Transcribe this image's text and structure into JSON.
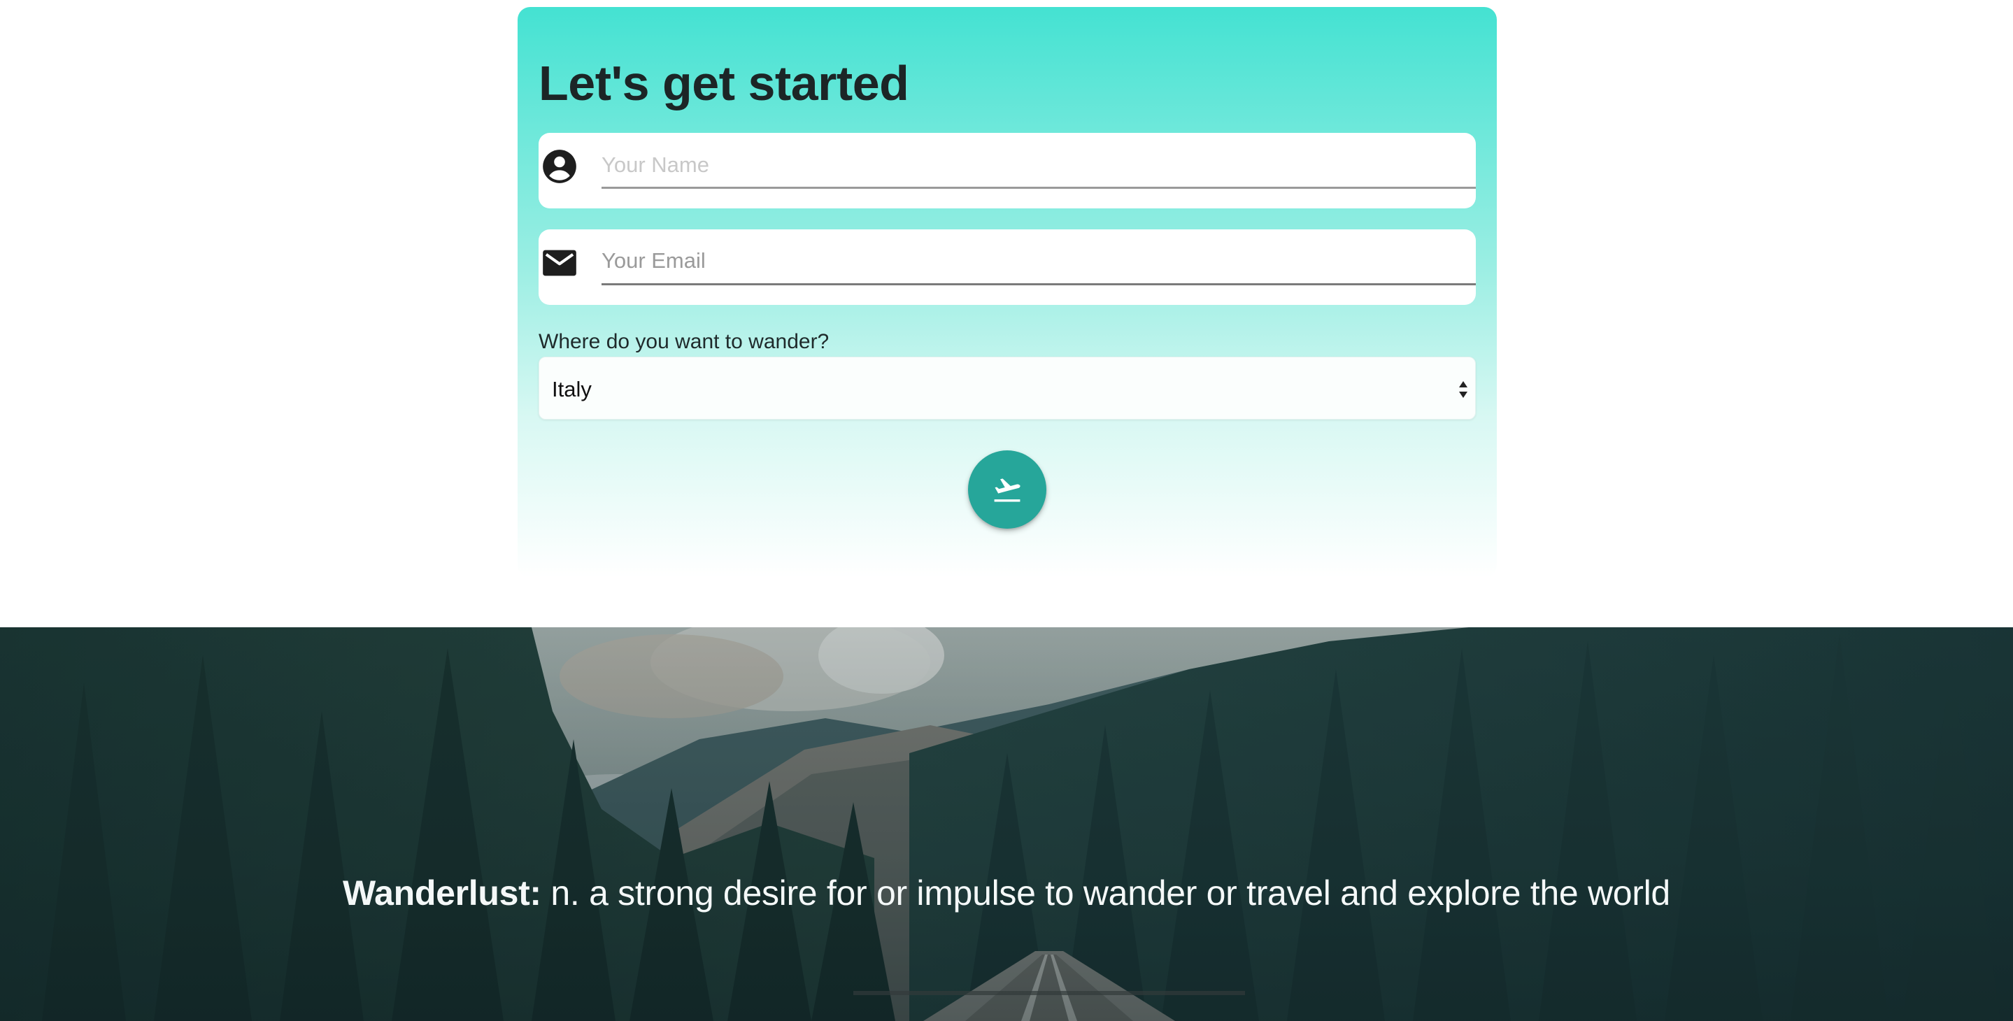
{
  "form": {
    "title": "Let's get started",
    "name_field": {
      "placeholder": "Your Name",
      "value": "",
      "icon": "account-circle-icon"
    },
    "email_field": {
      "placeholder": "Your Email",
      "value": "",
      "icon": "mail-icon"
    },
    "destination": {
      "label": "Where do you want to wander?",
      "selected": "Italy"
    },
    "submit_button": {
      "icon": "flight-takeoff-icon"
    }
  },
  "hero": {
    "term": "Wanderlust:",
    "definition": " n. a strong desire for or impulse to wander or travel and explore the world"
  },
  "colors": {
    "card_gradient_top": "#44e2d2",
    "card_gradient_bottom": "#ffffff",
    "button": "#26a69a",
    "title_text": "#1c2526",
    "hero_text": "#f4f8f8"
  }
}
